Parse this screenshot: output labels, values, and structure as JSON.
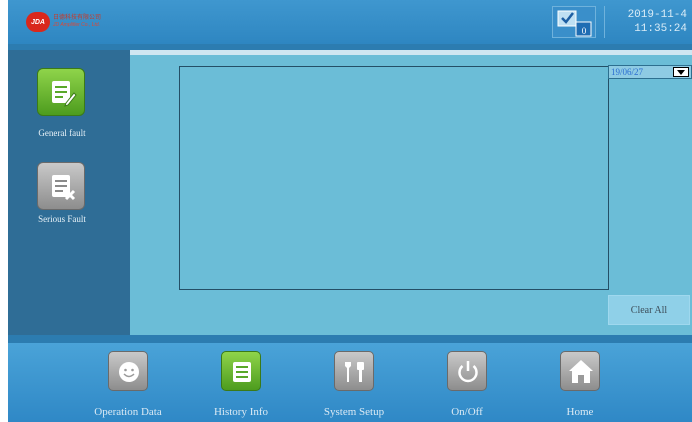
{
  "header": {
    "logo_badge": "JDA",
    "company_cn": "日德科技有限公司",
    "company_en": "JD Amplifier Co., Ltd.",
    "message_count": "0",
    "date": "2019-11-4",
    "time": "11:35:24"
  },
  "sidebar": {
    "items": [
      {
        "label": "General fault",
        "icon": "edit-document-icon"
      },
      {
        "label": "Serious Fault",
        "icon": "delete-document-icon"
      }
    ]
  },
  "main": {
    "date_filter": "19/06/27",
    "clear_label": "Clear All"
  },
  "nav": {
    "items": [
      {
        "label": "Operation Data",
        "icon": "smiley-icon"
      },
      {
        "label": "History Info",
        "icon": "list-icon"
      },
      {
        "label": "System Setup",
        "icon": "tools-icon"
      },
      {
        "label": "On/Off",
        "icon": "power-icon"
      },
      {
        "label": "Home",
        "icon": "home-icon"
      }
    ]
  },
  "colors": {
    "header": "#3f97cf",
    "sidebar": "#2f6d96",
    "panel": "#6bbdd7",
    "active_tile": "#6cb836"
  }
}
